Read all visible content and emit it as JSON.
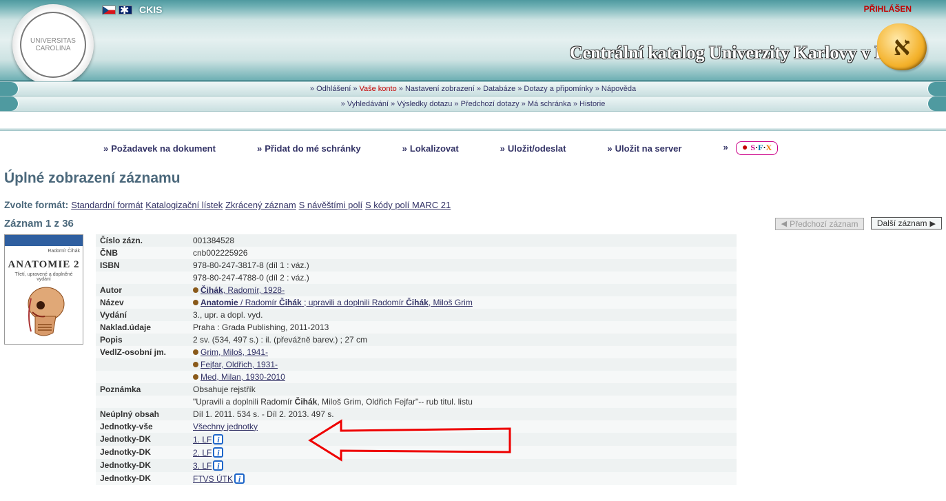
{
  "header": {
    "brand": "CKIS",
    "login_status": "PŘIHLÁŠEN",
    "title": "Centrální katalog Univerzity  Karlovy v Praze",
    "aleph_glyph": "א"
  },
  "nav1": {
    "items": [
      {
        "label": "Odhlášení",
        "active": false
      },
      {
        "label": "Vaše konto",
        "active": true
      },
      {
        "label": "Nastavení zobrazení",
        "active": false
      },
      {
        "label": "Databáze",
        "active": false
      },
      {
        "label": "Dotazy a připomínky",
        "active": false
      },
      {
        "label": "Nápověda",
        "active": false
      }
    ]
  },
  "nav2": {
    "items": [
      {
        "label": "Vyhledávání"
      },
      {
        "label": "Výsledky dotazu"
      },
      {
        "label": "Předchozí dotazy"
      },
      {
        "label": "Má schránka"
      },
      {
        "label": "Historie"
      }
    ]
  },
  "actions": {
    "items": [
      {
        "label": "Požadavek na dokument"
      },
      {
        "label": "Přidat do mé schránky"
      },
      {
        "label": "Lokalizovat"
      },
      {
        "label": "Uložit/odeslat"
      },
      {
        "label": "Uložit na server"
      }
    ],
    "sfx": {
      "s": "S",
      "f": "F",
      "x": "X",
      "bullet": "●"
    }
  },
  "page": {
    "title": "Úplné zobrazení záznamu",
    "format_label": "Zvolte formát:",
    "formats": [
      "Standardní formát",
      "Katalogizační lístek",
      "Zkrácený záznam",
      "S návěštími polí",
      "S kódy polí MARC 21"
    ],
    "rec_count": "Záznam 1 z 36",
    "prev_btn": "Předchozí záznam",
    "next_btn": "Další záznam"
  },
  "cover": {
    "author": "Radomír Čihák",
    "title": "ANATOMIE 2",
    "sub": "Třetí, upravené a doplněné vydání"
  },
  "record": {
    "rows": [
      {
        "label": "Číslo zázn.",
        "plain": "001384528"
      },
      {
        "label": "ČNB",
        "plain": "cnb002225926"
      },
      {
        "label": "ISBN",
        "plain": "978-80-247-3817-8 (díl 1 : váz.)"
      },
      {
        "label": "",
        "plain": "978-80-247-4788-0 (díl 2 : váz.)"
      },
      {
        "label": "Autor",
        "dot": true,
        "link": "Čihák, Radomír, 1928-",
        "boldpart": "Čihák"
      },
      {
        "label": "Název",
        "dot": true,
        "html_parts": [
          "**Anatomie** / Radomír **Čihák** ; upravili a doplnili Radomír **Čihák**, Miloš Grim"
        ],
        "link_all": true
      },
      {
        "label": "Vydání",
        "plain": "3., upr. a dopl. vyd."
      },
      {
        "label": "Naklad.údaje",
        "plain": "Praha : Grada Publishing, 2011-2013"
      },
      {
        "label": "Popis",
        "plain": "2 sv. (534, 497 s.) : il. (převážně barev.) ; 27 cm"
      },
      {
        "label": "VedlZ-osobní jm.",
        "dot": true,
        "link": "Grim, Miloš, 1941-"
      },
      {
        "label": "",
        "dot": true,
        "link": "Fejfar, Oldřich, 1931-"
      },
      {
        "label": "",
        "dot": true,
        "link": "Med, Milan, 1930-2010"
      },
      {
        "label": "Poznámka",
        "plain": "Obsahuje rejstřík"
      },
      {
        "label": "",
        "html_parts": [
          "\"Upravili a doplnili Radomír **Čihák**, Miloš Grim, Oldřich Fejfar\"-- rub titul. listu"
        ]
      },
      {
        "label": "Neúplný obsah",
        "plain": "Díl 1. 2011. 534 s. - Díl 2. 2013. 497 s."
      },
      {
        "label": "Jednotky-vše",
        "link": "Všechny jednotky"
      },
      {
        "label": "Jednotky-DK",
        "link": "1. LF",
        "info": true
      },
      {
        "label": "Jednotky-DK",
        "link": "2. LF",
        "info": true
      },
      {
        "label": "Jednotky-DK",
        "link": "3. LF",
        "info": true
      },
      {
        "label": "Jednotky-DK",
        "link": "FTVS ÚTK",
        "info": true
      }
    ]
  }
}
